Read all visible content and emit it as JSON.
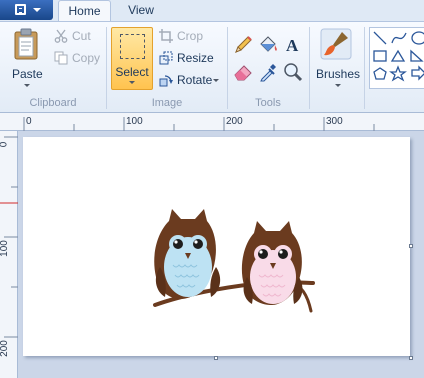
{
  "tabs": {
    "file_icon": "file-menu-icon",
    "home": "Home",
    "view": "View"
  },
  "clipboard": {
    "paste": "Paste",
    "cut": "Cut",
    "copy": "Copy",
    "label": "Clipboard"
  },
  "image": {
    "select": "Select",
    "crop": "Crop",
    "resize": "Resize",
    "rotate": "Rotate",
    "label": "Image"
  },
  "tools": {
    "label": "Tools",
    "items": [
      "pencil-icon",
      "fill-bucket-icon",
      "text-icon",
      "eraser-icon",
      "color-picker-icon",
      "magnifier-icon"
    ]
  },
  "brushes": {
    "label": "Brushes"
  },
  "ruler": {
    "horizontal": [
      "0",
      "100",
      "200",
      "300"
    ],
    "vertical": [
      "0",
      "100",
      "200"
    ]
  },
  "canvas": {
    "image": "two owls on a branch"
  },
  "colors": {
    "accent": "#2b579a",
    "select_active": "#ffc34f",
    "owl_brown": "#6b3b1f",
    "owl_blue": "#bde2f3",
    "owl_pink": "#f9dbe8"
  }
}
